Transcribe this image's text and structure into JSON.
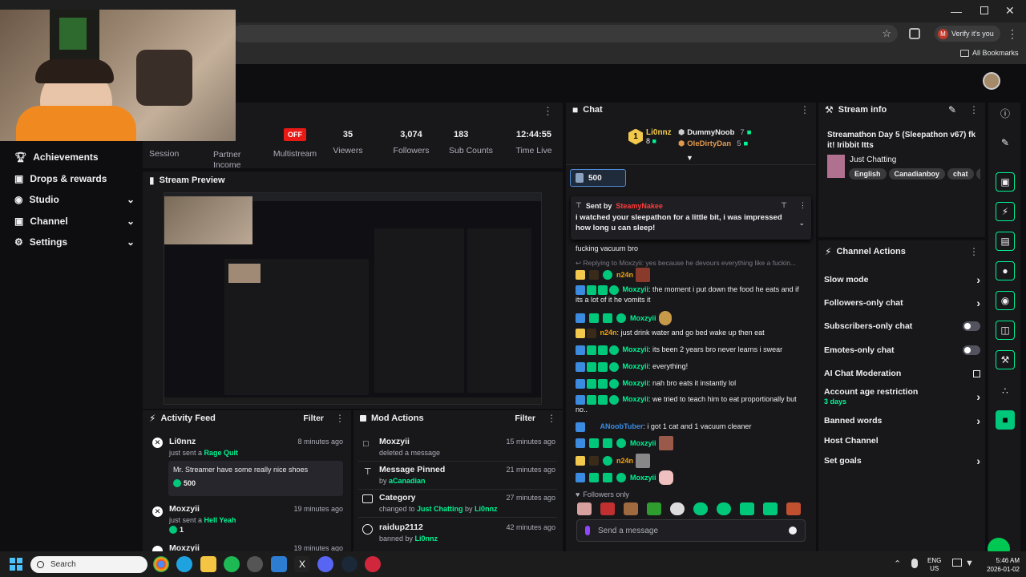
{
  "browser": {
    "verify_label": "Verify it's you",
    "bookmarks_label": "All Bookmarks",
    "avatar_letter": "M"
  },
  "sidebar": {
    "items": [
      {
        "label": "Achievements",
        "expand": false
      },
      {
        "label": "Drops & rewards",
        "expand": false
      },
      {
        "label": "Studio",
        "expand": true
      },
      {
        "label": "Channel",
        "expand": true
      },
      {
        "label": "Settings",
        "expand": true
      }
    ]
  },
  "stats": {
    "session_label": "Session",
    "partner_label": "Partner Income",
    "multistream_badge": "OFF",
    "multistream_label": "Multistream",
    "viewers": {
      "value": "35",
      "label": "Viewers"
    },
    "followers": {
      "value": "3,074",
      "label": "Followers"
    },
    "subs": {
      "value": "183",
      "label": "Sub Counts"
    },
    "time": {
      "value": "12:44:55",
      "label": "Time Live"
    }
  },
  "preview": {
    "title": "Stream Preview"
  },
  "activity": {
    "title": "Activity Feed",
    "filter": "Filter",
    "items": [
      {
        "user": "Li0nnz",
        "time": "8 minutes ago",
        "pre": "just sent a ",
        "reward": "Rage Quit",
        "message": "Mr. Streamer have some really nice shoes",
        "points": "500"
      },
      {
        "user": "Moxzyii",
        "time": "19 minutes ago",
        "pre": "just sent a ",
        "reward": "Hell Yeah",
        "points": "1"
      },
      {
        "user": "Moxzyii",
        "time": "19 minutes ago"
      }
    ]
  },
  "mod": {
    "title": "Mod Actions",
    "filter": "Filter",
    "items": [
      {
        "title": "Moxzyii",
        "time": "15 minutes ago",
        "sub": "deleted a message"
      },
      {
        "title": "Message Pinned",
        "time": "21 minutes ago",
        "sub": "by ",
        "sub_user": "aCanadian"
      },
      {
        "title": "Category",
        "time": "27 minutes ago",
        "sub": "changed to ",
        "sub_user": "Just Chatting",
        "sub2": " by ",
        "sub_user2": "Li0nnz"
      },
      {
        "title": "raidup2112",
        "time": "42 minutes ago",
        "sub": "banned by ",
        "sub_user": "Li0nnz"
      }
    ]
  },
  "chat": {
    "title": "Chat",
    "leader": {
      "rank": "1",
      "name": "Li0nnz",
      "count": "8"
    },
    "runners": [
      {
        "name": "DummyNoob",
        "count": "7"
      },
      {
        "name": "OleDirtyDan",
        "count": "5"
      }
    ],
    "points": "500",
    "pinned": {
      "label": "Sent by",
      "user": "SteamyNakee",
      "message": "i watched your sleepathon for a little bit, i was impressed how long u can sleep!"
    },
    "lines": [
      {
        "user": "",
        "text": "fucking vacuum bro"
      },
      {
        "user": "",
        "text": "Replying to Moxzyii: yes because he devours everything like a fuckin..."
      },
      {
        "user": "n24n",
        "text": ""
      },
      {
        "user": "Moxzyii",
        "text": "the moment i put down the food he eats and if its a lot of it he vomits it"
      },
      {
        "user": "Moxzyii",
        "text": ""
      },
      {
        "user": "n24n",
        "text": "just drink water and go bed wake up then eat"
      },
      {
        "user": "Moxzyii",
        "text": "its been 2 years bro never learns i swear"
      },
      {
        "user": "Moxzyii",
        "text": "everything!"
      },
      {
        "user": "Moxzyii",
        "text": "nah bro eats it instantly lol"
      },
      {
        "user": "Moxzyii",
        "text": "we tried to teach him to eat proportionally but no.."
      },
      {
        "user": "ANoobTuber",
        "text": "i got 1 cat and 1 vacuum cleaner"
      },
      {
        "user": "Moxzyii",
        "text": ""
      },
      {
        "user": "n24n",
        "text": ""
      },
      {
        "user": "Moxzyii",
        "text": ""
      }
    ],
    "followers_only": "Followers only",
    "placeholder": "Send a message"
  },
  "stream_info": {
    "title": "Stream info",
    "stream_title": "Streamathon Day 5 (Sleepathon v67) fk it! Iribbit Itts",
    "category": "Just Chatting",
    "tags": [
      "English",
      "Canadianboy",
      "chat",
      "fig"
    ]
  },
  "channel_actions": {
    "title": "Channel Actions",
    "items": [
      {
        "label": "Slow mode",
        "control": "arrow"
      },
      {
        "label": "Followers-only chat",
        "control": "arrow"
      },
      {
        "label": "Subscribers-only chat",
        "control": "toggle"
      },
      {
        "label": "Emotes-only chat",
        "control": "toggle"
      },
      {
        "label": "AI Chat Moderation",
        "control": "ext"
      },
      {
        "label": "Account age restriction",
        "sub": "3 days",
        "control": "arrow"
      },
      {
        "label": "Banned words",
        "control": "arrow"
      },
      {
        "label": "Host Channel",
        "control": "none"
      },
      {
        "label": "Set goals",
        "control": "arrow"
      }
    ]
  },
  "taskbar": {
    "search_placeholder": "Search",
    "lang": "ENG",
    "region": "US",
    "time": "5:46 AM",
    "date": "2026-01-02"
  }
}
